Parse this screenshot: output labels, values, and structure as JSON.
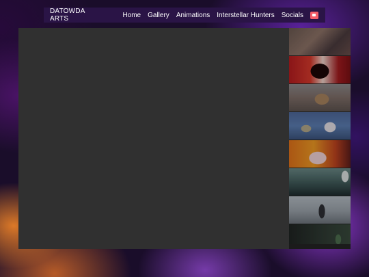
{
  "navbar": {
    "brand": "DATOWDA ARTS",
    "links": [
      "Home",
      "Gallery",
      "Animations",
      "Interstellar Hunters"
    ],
    "socials": "Socials",
    "kofi_icon": "kofi-cup-icon"
  },
  "viewer": {
    "background": "#303030"
  },
  "thumbnails": [
    {
      "icon": "artwork-thumbnail"
    },
    {
      "icon": "artwork-thumbnail"
    },
    {
      "icon": "artwork-thumbnail"
    },
    {
      "icon": "artwork-thumbnail"
    },
    {
      "icon": "artwork-thumbnail"
    },
    {
      "icon": "artwork-thumbnail"
    },
    {
      "icon": "artwork-thumbnail"
    },
    {
      "icon": "artwork-thumbnail"
    }
  ],
  "colors": {
    "navbar_bg": "#2a1446",
    "viewer_bg": "#303030",
    "kofi_red": "#f45d6a"
  }
}
